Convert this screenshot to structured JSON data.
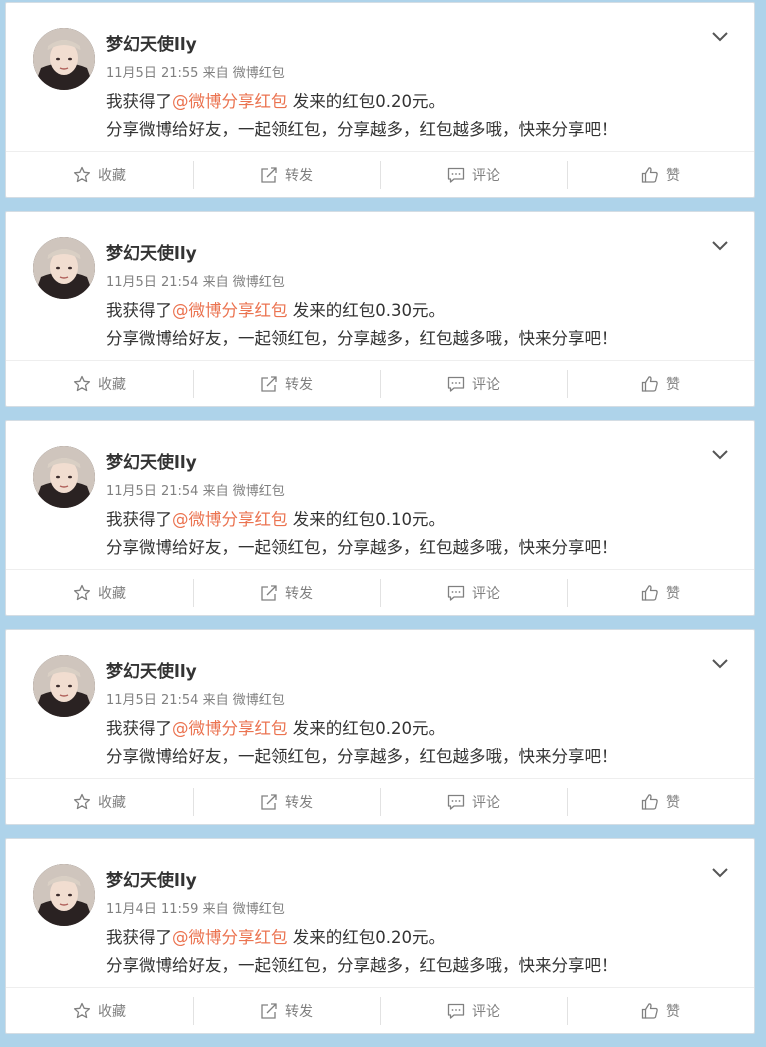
{
  "posts": [
    {
      "username": "梦幻天使lly",
      "time": "11月5日 21:55",
      "from_prefix": "来自",
      "from_app": "微博红包",
      "text_prefix": "我获得了",
      "mention": "@微博分享红包",
      "text_suffix": " 发来的红包0.20元。",
      "line2": "分享微博给好友，一起领红包，分享越多，红包越多哦，快来分享吧！"
    },
    {
      "username": "梦幻天使lly",
      "time": "11月5日 21:54",
      "from_prefix": "来自",
      "from_app": "微博红包",
      "text_prefix": "我获得了",
      "mention": "@微博分享红包",
      "text_suffix": " 发来的红包0.30元。",
      "line2": "分享微博给好友，一起领红包，分享越多，红包越多哦，快来分享吧！"
    },
    {
      "username": "梦幻天使lly",
      "time": "11月5日 21:54",
      "from_prefix": "来自",
      "from_app": "微博红包",
      "text_prefix": "我获得了",
      "mention": "@微博分享红包",
      "text_suffix": " 发来的红包0.10元。",
      "line2": "分享微博给好友，一起领红包，分享越多，红包越多哦，快来分享吧！"
    },
    {
      "username": "梦幻天使lly",
      "time": "11月5日 21:54",
      "from_prefix": "来自",
      "from_app": "微博红包",
      "text_prefix": "我获得了",
      "mention": "@微博分享红包",
      "text_suffix": " 发来的红包0.20元。",
      "line2": "分享微博给好友，一起领红包，分享越多，红包越多哦，快来分享吧！"
    },
    {
      "username": "梦幻天使lly",
      "time": "11月4日 11:59",
      "from_prefix": "来自",
      "from_app": "微博红包",
      "text_prefix": "我获得了",
      "mention": "@微博分享红包",
      "text_suffix": " 发来的红包0.20元。",
      "line2": "分享微博给好友，一起领红包，分享越多，红包越多哦，快来分享吧！"
    }
  ],
  "actions": {
    "favorite": "收藏",
    "repost": "转发",
    "comment": "评论",
    "like": "赞"
  },
  "icons": {
    "favorite": "star-icon",
    "repost": "repost-icon",
    "comment": "comment-icon",
    "like": "thumbs-up-icon",
    "menu": "chevron-down-icon"
  },
  "colors": {
    "background": "#aed3ea",
    "mention": "#eb7350",
    "text": "#333333",
    "meta": "#808080"
  }
}
